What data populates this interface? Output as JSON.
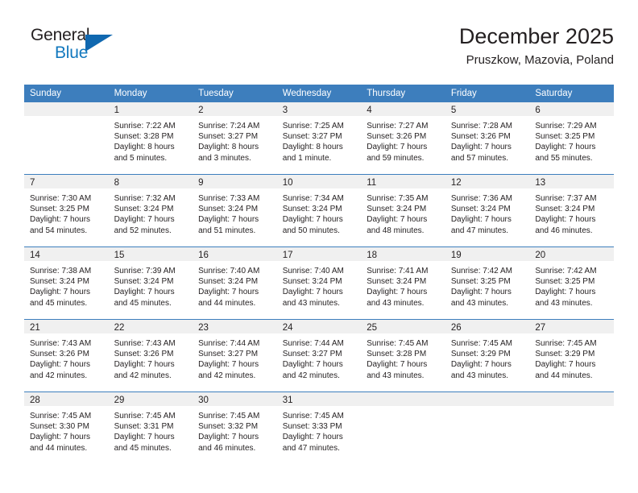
{
  "logo": {
    "word_top": "General",
    "word_bottom": "Blue",
    "triangle_color": "#1068b0",
    "blue_text_color": "#1278be"
  },
  "header": {
    "title": "December 2025",
    "location": "Pruszkow, Mazovia, Poland"
  },
  "theme": {
    "header_bg": "#3d7ebd",
    "header_text": "#ffffff",
    "daynum_bg": "#f0f0f0",
    "body_text": "#231f20",
    "grid_line": "#3d7ebd"
  },
  "weekday_headers": [
    "Sunday",
    "Monday",
    "Tuesday",
    "Wednesday",
    "Thursday",
    "Friday",
    "Saturday"
  ],
  "weeks": [
    [
      {
        "day": "",
        "sunrise": "",
        "sunset": "",
        "daylight_line1": "",
        "daylight_line2": ""
      },
      {
        "day": "1",
        "sunrise": "Sunrise: 7:22 AM",
        "sunset": "Sunset: 3:28 PM",
        "daylight_line1": "Daylight: 8 hours",
        "daylight_line2": "and 5 minutes."
      },
      {
        "day": "2",
        "sunrise": "Sunrise: 7:24 AM",
        "sunset": "Sunset: 3:27 PM",
        "daylight_line1": "Daylight: 8 hours",
        "daylight_line2": "and 3 minutes."
      },
      {
        "day": "3",
        "sunrise": "Sunrise: 7:25 AM",
        "sunset": "Sunset: 3:27 PM",
        "daylight_line1": "Daylight: 8 hours",
        "daylight_line2": "and 1 minute."
      },
      {
        "day": "4",
        "sunrise": "Sunrise: 7:27 AM",
        "sunset": "Sunset: 3:26 PM",
        "daylight_line1": "Daylight: 7 hours",
        "daylight_line2": "and 59 minutes."
      },
      {
        "day": "5",
        "sunrise": "Sunrise: 7:28 AM",
        "sunset": "Sunset: 3:26 PM",
        "daylight_line1": "Daylight: 7 hours",
        "daylight_line2": "and 57 minutes."
      },
      {
        "day": "6",
        "sunrise": "Sunrise: 7:29 AM",
        "sunset": "Sunset: 3:25 PM",
        "daylight_line1": "Daylight: 7 hours",
        "daylight_line2": "and 55 minutes."
      }
    ],
    [
      {
        "day": "7",
        "sunrise": "Sunrise: 7:30 AM",
        "sunset": "Sunset: 3:25 PM",
        "daylight_line1": "Daylight: 7 hours",
        "daylight_line2": "and 54 minutes."
      },
      {
        "day": "8",
        "sunrise": "Sunrise: 7:32 AM",
        "sunset": "Sunset: 3:24 PM",
        "daylight_line1": "Daylight: 7 hours",
        "daylight_line2": "and 52 minutes."
      },
      {
        "day": "9",
        "sunrise": "Sunrise: 7:33 AM",
        "sunset": "Sunset: 3:24 PM",
        "daylight_line1": "Daylight: 7 hours",
        "daylight_line2": "and 51 minutes."
      },
      {
        "day": "10",
        "sunrise": "Sunrise: 7:34 AM",
        "sunset": "Sunset: 3:24 PM",
        "daylight_line1": "Daylight: 7 hours",
        "daylight_line2": "and 50 minutes."
      },
      {
        "day": "11",
        "sunrise": "Sunrise: 7:35 AM",
        "sunset": "Sunset: 3:24 PM",
        "daylight_line1": "Daylight: 7 hours",
        "daylight_line2": "and 48 minutes."
      },
      {
        "day": "12",
        "sunrise": "Sunrise: 7:36 AM",
        "sunset": "Sunset: 3:24 PM",
        "daylight_line1": "Daylight: 7 hours",
        "daylight_line2": "and 47 minutes."
      },
      {
        "day": "13",
        "sunrise": "Sunrise: 7:37 AM",
        "sunset": "Sunset: 3:24 PM",
        "daylight_line1": "Daylight: 7 hours",
        "daylight_line2": "and 46 minutes."
      }
    ],
    [
      {
        "day": "14",
        "sunrise": "Sunrise: 7:38 AM",
        "sunset": "Sunset: 3:24 PM",
        "daylight_line1": "Daylight: 7 hours",
        "daylight_line2": "and 45 minutes."
      },
      {
        "day": "15",
        "sunrise": "Sunrise: 7:39 AM",
        "sunset": "Sunset: 3:24 PM",
        "daylight_line1": "Daylight: 7 hours",
        "daylight_line2": "and 45 minutes."
      },
      {
        "day": "16",
        "sunrise": "Sunrise: 7:40 AM",
        "sunset": "Sunset: 3:24 PM",
        "daylight_line1": "Daylight: 7 hours",
        "daylight_line2": "and 44 minutes."
      },
      {
        "day": "17",
        "sunrise": "Sunrise: 7:40 AM",
        "sunset": "Sunset: 3:24 PM",
        "daylight_line1": "Daylight: 7 hours",
        "daylight_line2": "and 43 minutes."
      },
      {
        "day": "18",
        "sunrise": "Sunrise: 7:41 AM",
        "sunset": "Sunset: 3:24 PM",
        "daylight_line1": "Daylight: 7 hours",
        "daylight_line2": "and 43 minutes."
      },
      {
        "day": "19",
        "sunrise": "Sunrise: 7:42 AM",
        "sunset": "Sunset: 3:25 PM",
        "daylight_line1": "Daylight: 7 hours",
        "daylight_line2": "and 43 minutes."
      },
      {
        "day": "20",
        "sunrise": "Sunrise: 7:42 AM",
        "sunset": "Sunset: 3:25 PM",
        "daylight_line1": "Daylight: 7 hours",
        "daylight_line2": "and 43 minutes."
      }
    ],
    [
      {
        "day": "21",
        "sunrise": "Sunrise: 7:43 AM",
        "sunset": "Sunset: 3:26 PM",
        "daylight_line1": "Daylight: 7 hours",
        "daylight_line2": "and 42 minutes."
      },
      {
        "day": "22",
        "sunrise": "Sunrise: 7:43 AM",
        "sunset": "Sunset: 3:26 PM",
        "daylight_line1": "Daylight: 7 hours",
        "daylight_line2": "and 42 minutes."
      },
      {
        "day": "23",
        "sunrise": "Sunrise: 7:44 AM",
        "sunset": "Sunset: 3:27 PM",
        "daylight_line1": "Daylight: 7 hours",
        "daylight_line2": "and 42 minutes."
      },
      {
        "day": "24",
        "sunrise": "Sunrise: 7:44 AM",
        "sunset": "Sunset: 3:27 PM",
        "daylight_line1": "Daylight: 7 hours",
        "daylight_line2": "and 42 minutes."
      },
      {
        "day": "25",
        "sunrise": "Sunrise: 7:45 AM",
        "sunset": "Sunset: 3:28 PM",
        "daylight_line1": "Daylight: 7 hours",
        "daylight_line2": "and 43 minutes."
      },
      {
        "day": "26",
        "sunrise": "Sunrise: 7:45 AM",
        "sunset": "Sunset: 3:29 PM",
        "daylight_line1": "Daylight: 7 hours",
        "daylight_line2": "and 43 minutes."
      },
      {
        "day": "27",
        "sunrise": "Sunrise: 7:45 AM",
        "sunset": "Sunset: 3:29 PM",
        "daylight_line1": "Daylight: 7 hours",
        "daylight_line2": "and 44 minutes."
      }
    ],
    [
      {
        "day": "28",
        "sunrise": "Sunrise: 7:45 AM",
        "sunset": "Sunset: 3:30 PM",
        "daylight_line1": "Daylight: 7 hours",
        "daylight_line2": "and 44 minutes."
      },
      {
        "day": "29",
        "sunrise": "Sunrise: 7:45 AM",
        "sunset": "Sunset: 3:31 PM",
        "daylight_line1": "Daylight: 7 hours",
        "daylight_line2": "and 45 minutes."
      },
      {
        "day": "30",
        "sunrise": "Sunrise: 7:45 AM",
        "sunset": "Sunset: 3:32 PM",
        "daylight_line1": "Daylight: 7 hours",
        "daylight_line2": "and 46 minutes."
      },
      {
        "day": "31",
        "sunrise": "Sunrise: 7:45 AM",
        "sunset": "Sunset: 3:33 PM",
        "daylight_line1": "Daylight: 7 hours",
        "daylight_line2": "and 47 minutes."
      },
      {
        "day": "",
        "sunrise": "",
        "sunset": "",
        "daylight_line1": "",
        "daylight_line2": ""
      },
      {
        "day": "",
        "sunrise": "",
        "sunset": "",
        "daylight_line1": "",
        "daylight_line2": ""
      },
      {
        "day": "",
        "sunrise": "",
        "sunset": "",
        "daylight_line1": "",
        "daylight_line2": ""
      }
    ]
  ]
}
